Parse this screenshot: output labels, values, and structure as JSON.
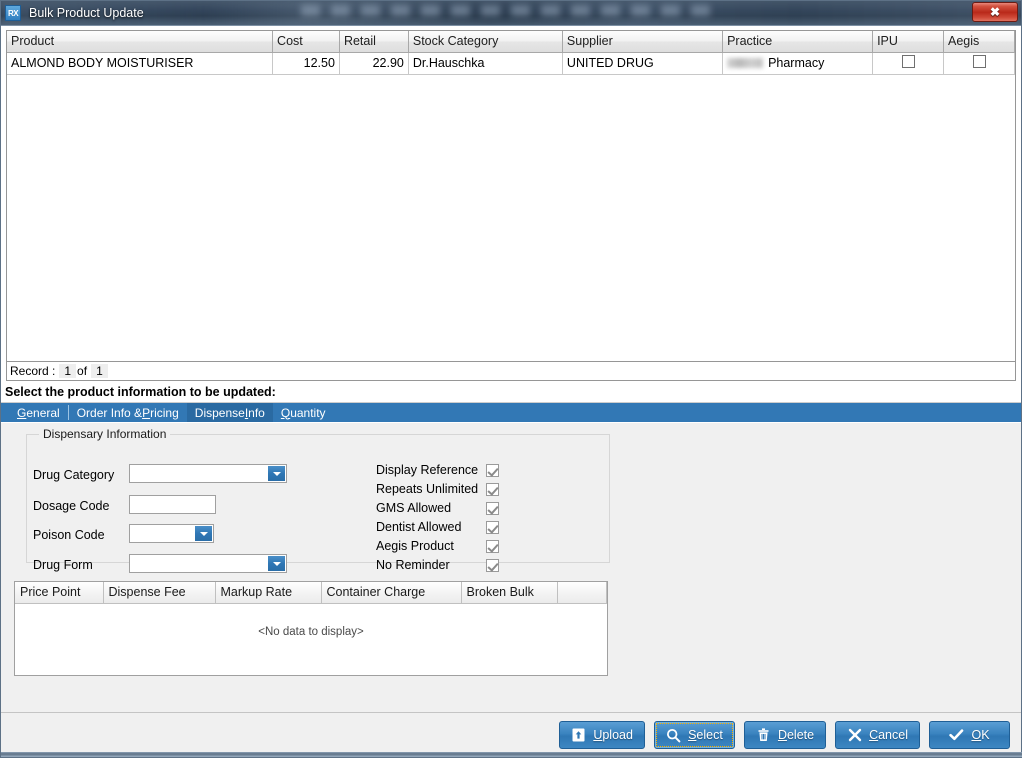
{
  "window": {
    "title": "Bulk Product Update",
    "app_icon": "RX",
    "close_label": "✖"
  },
  "product_grid": {
    "columns": [
      "Product",
      "Cost",
      "Retail",
      "Stock Category",
      "Supplier",
      "Practice",
      "IPU",
      "Aegis"
    ],
    "rows": [
      {
        "product": "ALMOND BODY MOISTURISER",
        "cost": "12.50",
        "retail": "22.90",
        "stock_category": "Dr.Hauschka",
        "supplier": "UNITED DRUG",
        "practice": "Pharmacy",
        "practice_redacted": true,
        "ipu": false,
        "aegis": false
      }
    ]
  },
  "record_bar": {
    "label": "Record :",
    "current": "1",
    "of": "of",
    "total": "1"
  },
  "instruction": "Select the product information to be updated:",
  "tabs": [
    {
      "label": "General",
      "accel": "G",
      "selected": false
    },
    {
      "label": "Order Info & Pricing",
      "accel": "P",
      "selected": false
    },
    {
      "label": "Dispense Info",
      "accel": "I",
      "selected": true
    },
    {
      "label": "Quantity",
      "accel": "Q",
      "selected": false
    }
  ],
  "dispensary": {
    "group_title": "Dispensary Information",
    "fields": [
      {
        "label": "Drug Category",
        "type": "combo",
        "value": ""
      },
      {
        "label": "Dosage Code",
        "type": "text",
        "value": "",
        "placeholder": ""
      },
      {
        "label": "Poison Code",
        "type": "combo",
        "value": ""
      },
      {
        "label": "Drug Form",
        "type": "combo",
        "value": ""
      }
    ],
    "checkboxes": [
      {
        "label": "Display Reference",
        "checked": true
      },
      {
        "label": "Repeats Unlimited",
        "checked": true
      },
      {
        "label": "GMS Allowed",
        "checked": true
      },
      {
        "label": "Dentist Allowed",
        "checked": true
      },
      {
        "label": "Aegis Product",
        "checked": true
      },
      {
        "label": "No Reminder",
        "checked": true
      }
    ]
  },
  "price_grid": {
    "columns": [
      "Price Point",
      "Dispense Fee",
      "Markup Rate",
      "Container Charge",
      "Broken Bulk"
    ],
    "empty_message": "<No data to display>",
    "rows": []
  },
  "buttons": [
    {
      "label": "Upload",
      "accel": "U",
      "icon": "upload-icon",
      "focused": false
    },
    {
      "label": "Select",
      "accel": "S",
      "icon": "search-icon",
      "focused": true
    },
    {
      "label": "Delete",
      "accel": "D",
      "icon": "trash-icon",
      "focused": false
    },
    {
      "label": "Cancel",
      "accel": "C",
      "icon": "close-x-icon",
      "focused": false
    },
    {
      "label": "OK",
      "accel": "O",
      "icon": "check-icon",
      "focused": false
    }
  ],
  "colors": {
    "accent_blue": "#3278b5",
    "tab_selected": "#2a6aa2",
    "button_blue": "#3a83bf",
    "focus_outline": "#ffb400",
    "close_red": "#b9291a"
  }
}
